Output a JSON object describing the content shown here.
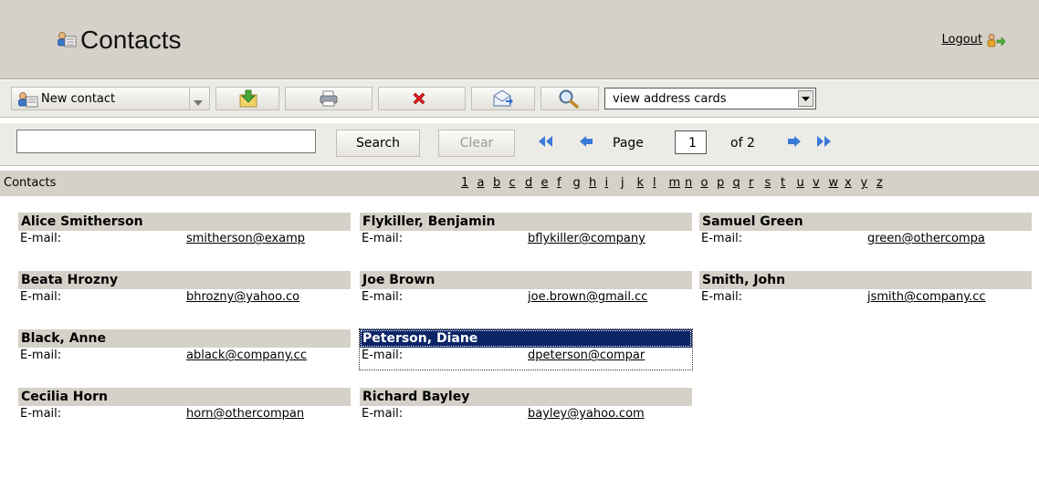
{
  "header": {
    "title": "Contacts",
    "logout": "Logout"
  },
  "toolbar": {
    "new_contact": "New contact",
    "view_select": "view address cards"
  },
  "search": {
    "value": "",
    "button": "Search",
    "clear": "Clear"
  },
  "pager": {
    "page_label": "Page",
    "page_value": "1",
    "of_label": "of 2"
  },
  "list": {
    "title": "Contacts",
    "alphabet": [
      "1",
      "a",
      "b",
      "c",
      "d",
      "e",
      "f",
      "g",
      "h",
      "i",
      "j",
      "k",
      "l",
      "m",
      "n",
      "o",
      "p",
      "q",
      "r",
      "s",
      "t",
      "u",
      "v",
      "w",
      "x",
      "y",
      "z"
    ]
  },
  "email_label": "E-mail:",
  "contacts": [
    {
      "name": "Alice Smitherson",
      "email": "smitherson@examp"
    },
    {
      "name": "Beata Hrozny",
      "email": "bhrozny@yahoo.co"
    },
    {
      "name": "Black, Anne",
      "email": "ablack@company.cc"
    },
    {
      "name": "Cecilia Horn",
      "email": "horn@othercompan"
    },
    {
      "name": "Flykiller, Benjamin",
      "email": "bflykiller@company"
    },
    {
      "name": "Joe Brown",
      "email": "joe.brown@gmail.cc"
    },
    {
      "name": "Peterson, Diane",
      "email": "dpeterson@compar",
      "selected": true
    },
    {
      "name": "Richard Bayley",
      "email": "bayley@yahoo.com"
    },
    {
      "name": "Samuel Green",
      "email": "green@othercompa"
    },
    {
      "name": "Smith, John",
      "email": "jsmith@company.cc"
    }
  ],
  "colors": {
    "header_bg": "#d5d1c8",
    "toolbar_bg": "#ecebe6",
    "selected_bg": "#0b2466"
  },
  "icons": [
    "contacts-icon",
    "logout-icon",
    "new-contact-icon",
    "dropdown-arrow-icon",
    "import-icon",
    "print-icon",
    "delete-icon",
    "send-mail-icon",
    "search-icon",
    "first-page-icon",
    "prev-page-icon",
    "next-page-icon",
    "last-page-icon"
  ]
}
